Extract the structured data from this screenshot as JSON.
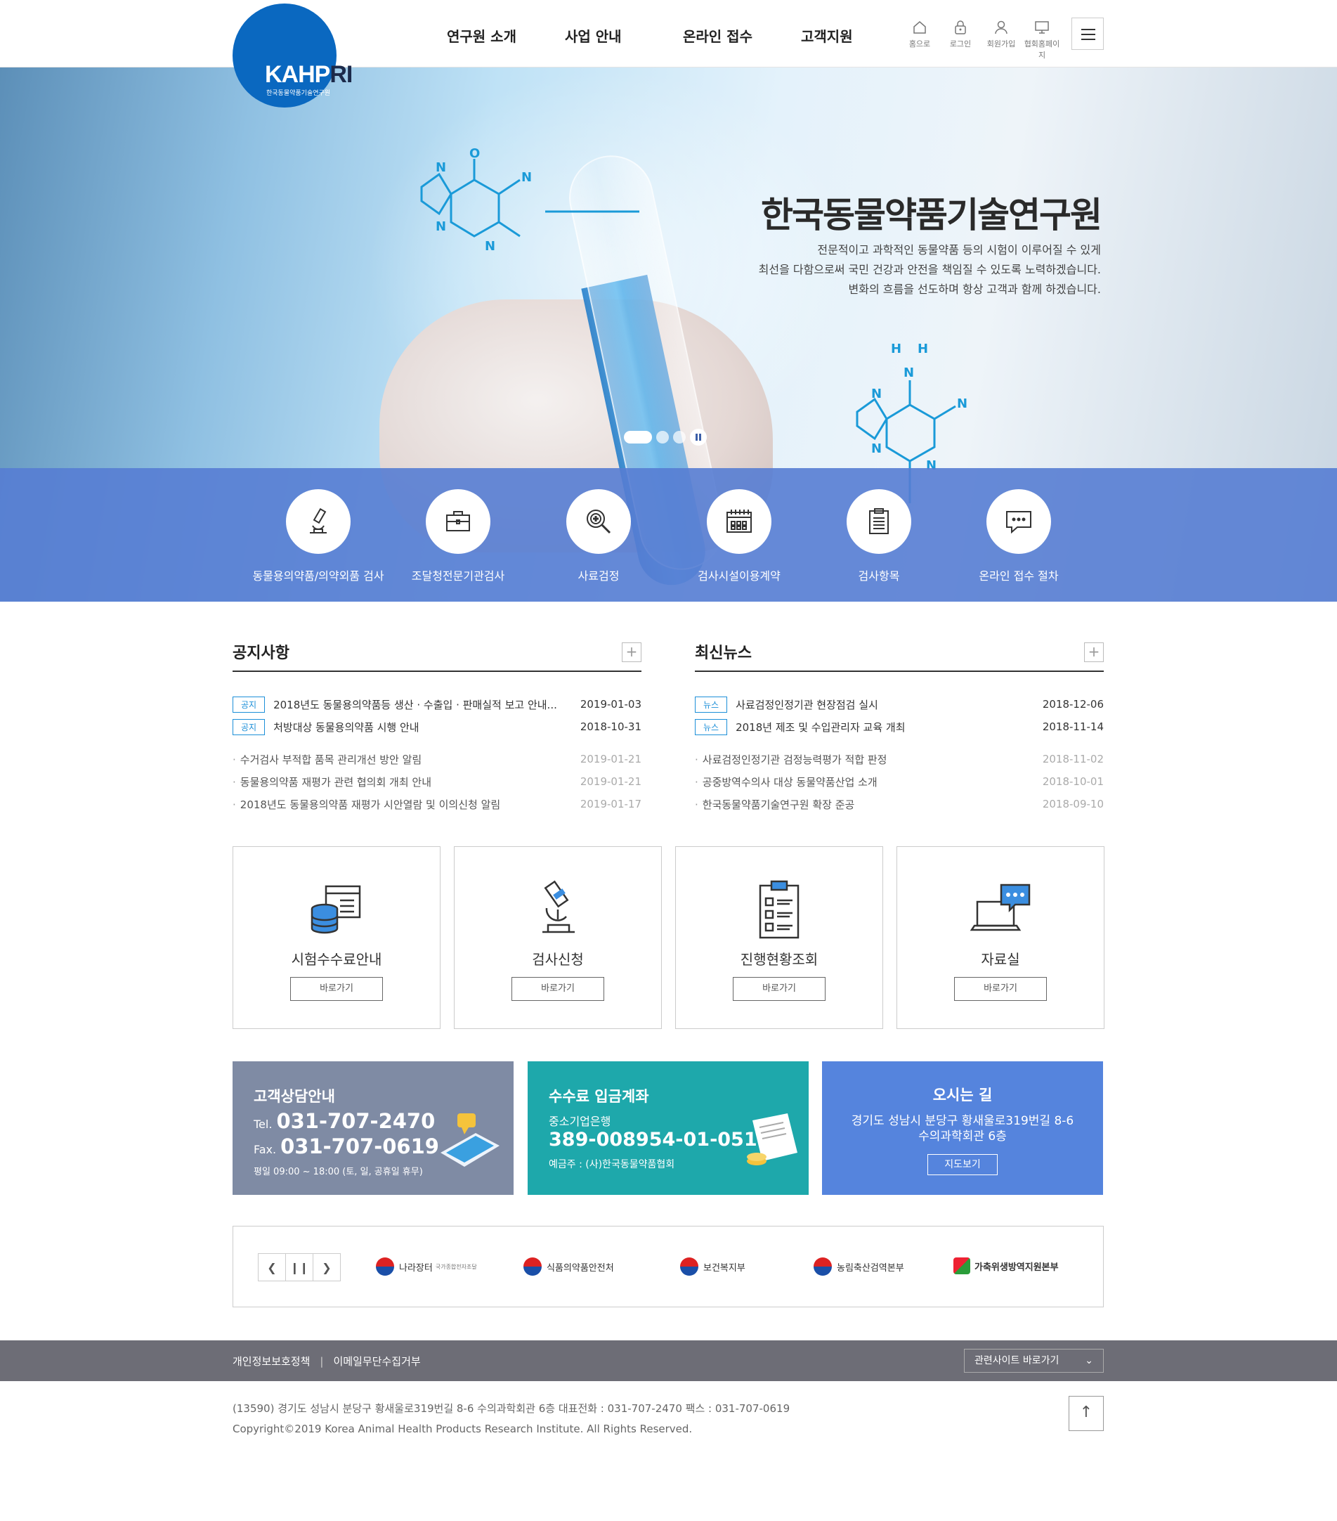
{
  "logo": {
    "text_a": "KAHP",
    "text_b": "RI",
    "sub": "한국동물약품기술연구원"
  },
  "gnb": [
    "연구원 소개",
    "사업 안내",
    "온라인 접수",
    "고객지원"
  ],
  "util": [
    {
      "label": "홈으로",
      "icon": "home-icon"
    },
    {
      "label": "로그인",
      "icon": "lock-icon"
    },
    {
      "label": "회원가입",
      "icon": "user-icon"
    },
    {
      "label": "협회홈페이지",
      "icon": "monitor-icon"
    }
  ],
  "hero": {
    "title": "한국동물약품기술연구원",
    "lines": [
      "전문적이고 과학적인 동물약품 등의 시험이 이루어질 수 있게",
      "최선을 다함으로써 국민 건강과 안전을 책임질 수 있도록 노력하겠습니다.",
      "변화의 흐름을 선도하며 항상 고객과 함께 하겠습니다."
    ],
    "slide_current": 1,
    "slide_total": 3
  },
  "quick": [
    {
      "label": "동물용의약품/의약외품 검사",
      "icon": "microscope-icon"
    },
    {
      "label": "조달청전문기관검사",
      "icon": "briefcase-icon"
    },
    {
      "label": "사료검정",
      "icon": "magnifier-icon"
    },
    {
      "label": "검사시설이용계약",
      "icon": "calendar-icon"
    },
    {
      "label": "검사항목",
      "icon": "clipboard-icon"
    },
    {
      "label": "온라인 접수 절차",
      "icon": "chat-icon"
    }
  ],
  "notice": {
    "title": "공지사항",
    "more": "+",
    "hot": [
      {
        "tag": "공지",
        "title": "2018년도 동물용의약품등 생산 · 수출입 · 판매실적 보고 안내...",
        "date": "2019-01-03"
      },
      {
        "tag": "공지",
        "title": "처방대상 동물용의약품 시행 안내",
        "date": "2018-10-31"
      }
    ],
    "list": [
      {
        "title": "수거검사 부적합 품목 관리개선 방안 알림",
        "date": "2019-01-21"
      },
      {
        "title": "동물용의약품 재평가 관련 협의회 개최 안내",
        "date": "2019-01-21"
      },
      {
        "title": "2018년도 동물용의약품 재평가 시안열람 및 이의신청 알림",
        "date": "2019-01-17"
      }
    ]
  },
  "news": {
    "title": "최신뉴스",
    "more": "+",
    "hot": [
      {
        "tag": "뉴스",
        "title": "사료검정인정기관 현장점검 실시",
        "date": "2018-12-06"
      },
      {
        "tag": "뉴스",
        "title": "2018년 제조 및 수입관리자 교육 개최",
        "date": "2018-11-14"
      }
    ],
    "list": [
      {
        "title": "사료검정인정기관 검정능력평가 적합 판정",
        "date": "2018-11-02"
      },
      {
        "title": "공중방역수의사 대상 동물약품산업 소개",
        "date": "2018-10-01"
      },
      {
        "title": "한국동물약품기술연구원 확장 준공",
        "date": "2018-09-10"
      }
    ]
  },
  "services": [
    {
      "name": "시험수수료안내",
      "go": "바로가기",
      "icon": "database-icon"
    },
    {
      "name": "검사신청",
      "go": "바로가기",
      "icon": "microscope-icon"
    },
    {
      "name": "진행현황조회",
      "go": "바로가기",
      "icon": "checklist-icon"
    },
    {
      "name": "자료실",
      "go": "바로가기",
      "icon": "laptop-chat-icon"
    }
  ],
  "info": {
    "cs": {
      "title": "고객상담안내",
      "tel_label": "Tel.",
      "tel": "031-707-2470",
      "fax_label": "Fax.",
      "fax": "031-707-0619",
      "hours": "평일 09:00 ~ 18:00 (토, 일, 공휴일 휴무)"
    },
    "bank": {
      "title": "수수료 입금계좌",
      "bank": "중소기업은행",
      "account": "389-008954-01-051",
      "owner": "예금주 : (사)한국동물약품협회"
    },
    "map": {
      "title": "오시는 길",
      "addr1": "경기도 성남시 분당구 황새울로319번길 8-6",
      "addr2": "수의과학회관 6층",
      "button": "지도보기"
    }
  },
  "partners": [
    {
      "name": "나라장터",
      "sub": "국가종합전자조달"
    },
    {
      "name": "식품의약품안전처"
    },
    {
      "name": "보건복지부"
    },
    {
      "name": "농림축산검역본부"
    },
    {
      "name": "가축위생방역지원본부"
    }
  ],
  "footer": {
    "links": [
      "개인정보보호정책",
      "이메일무단수집거부"
    ],
    "family": "관련사이트 바로가기",
    "address": "(13590) 경기도 성남시 분당구 황새울로319번길 8-6 수의과학회관 6층 대표전화 : 031-707-2470  팩스 : 031-707-0619",
    "copyright": "Copyright©2019 Korea Animal Health Products Research Institute. All Rights Reserved."
  },
  "colors": {
    "brand": "#0a68c0",
    "quickbar": "#567dd3",
    "cs": "#7f8ba4",
    "bank": "#1ea8ab",
    "map": "#5584dd",
    "tag": "#1c8fd8",
    "footer": "#6d6d76"
  }
}
